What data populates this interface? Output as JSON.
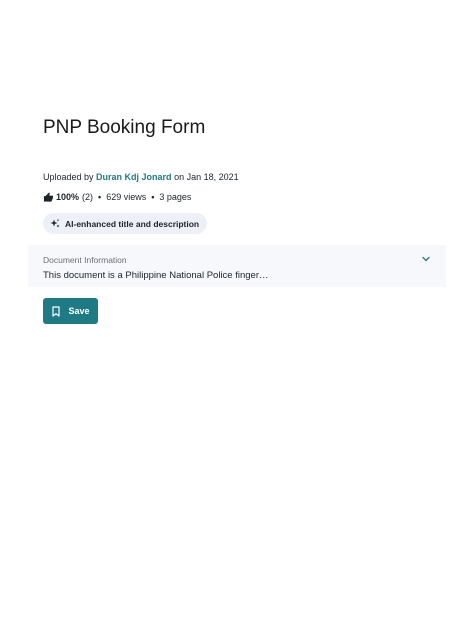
{
  "document": {
    "title": "PNP Booking Form",
    "uploaded_prefix": "Uploaded by ",
    "author": "Duran Kdj Jonard",
    "uploaded_suffix": " on Jan 18, 2021"
  },
  "stats": {
    "rating": "100%",
    "rating_count": "(2)",
    "views": "629 views",
    "pages": "3 pages",
    "separator": "•"
  },
  "ai_badge": {
    "label": "AI-enhanced title and description"
  },
  "doc_info": {
    "label": "Document Information",
    "description": "This document is a Philippine National Police finger…"
  },
  "actions": {
    "save_label": "Save"
  },
  "colors": {
    "accent": "#1e7b85",
    "badge_bg": "#eef0f7",
    "panel_bg": "#f7f8fb"
  },
  "icons": {
    "rating": "thumbs-up-icon",
    "ai": "sparkle-icon",
    "expand": "chevron-down-icon",
    "save": "bookmark-icon"
  }
}
